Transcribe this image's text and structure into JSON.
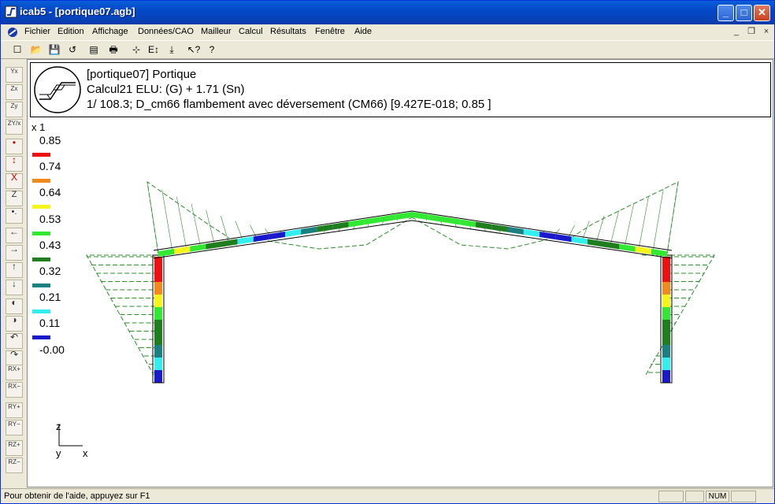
{
  "window": {
    "title": "icab5 - [portique07.agb]"
  },
  "menu": [
    "Fichier",
    "Edition",
    "Affichage",
    "Données/CAO",
    "Mailleur",
    "Calcul",
    "Résultats",
    "Fenêtre",
    "Aide"
  ],
  "mdi_controls": [
    "_",
    "❐",
    "×"
  ],
  "info": {
    "line1": "[portique07] Portique",
    "line2": "Calcul21 ELU: (G) + 1.71 (Sn)",
    "line3": "1/ 108.3; D_cm66 flambement avec déversement (CM66) [9.427E-018; 0.85 ]"
  },
  "legend": {
    "scale": "x 1",
    "values": [
      "0.85",
      "0.74",
      "0.64",
      "0.53",
      "0.43",
      "0.32",
      "0.21",
      "0.11",
      "-0.00"
    ],
    "colors": [
      "#ee1111",
      "#f08a1c",
      "#f5f51a",
      "#33e833",
      "#1f7f1f",
      "#1a8080",
      "#33eeee",
      "#1a1acc"
    ]
  },
  "axes": {
    "z": "z",
    "y": "y",
    "x": "x"
  },
  "statusbar": {
    "text": "Pour obtenir de l'aide, appuyez sur F1",
    "num": "NUM"
  },
  "left_toolbar": [
    "Yx",
    "Zx",
    "Zy",
    "ZY/x",
    "•",
    "↕",
    "X",
    "Z",
    "•.",
    "←",
    "→",
    "↑",
    "↓",
    "◐",
    "◑",
    "↶",
    "↷",
    "RX+",
    "RX−",
    "RY+",
    "RY−",
    "RZ+",
    "RZ−"
  ],
  "toolbar_icons": [
    "new-icon",
    "open-icon",
    "save-icon",
    "undo-icon",
    "preview-icon",
    "print-icon",
    "select-icon",
    "ei-icon",
    "download-icon",
    "help-pointer-icon",
    "help-icon"
  ],
  "toolbar_glyphs": [
    "☐",
    "📂",
    "💾",
    "↺",
    "▤",
    "🖶",
    "⊹",
    "E↕",
    "⤓",
    "↖?",
    "?"
  ]
}
